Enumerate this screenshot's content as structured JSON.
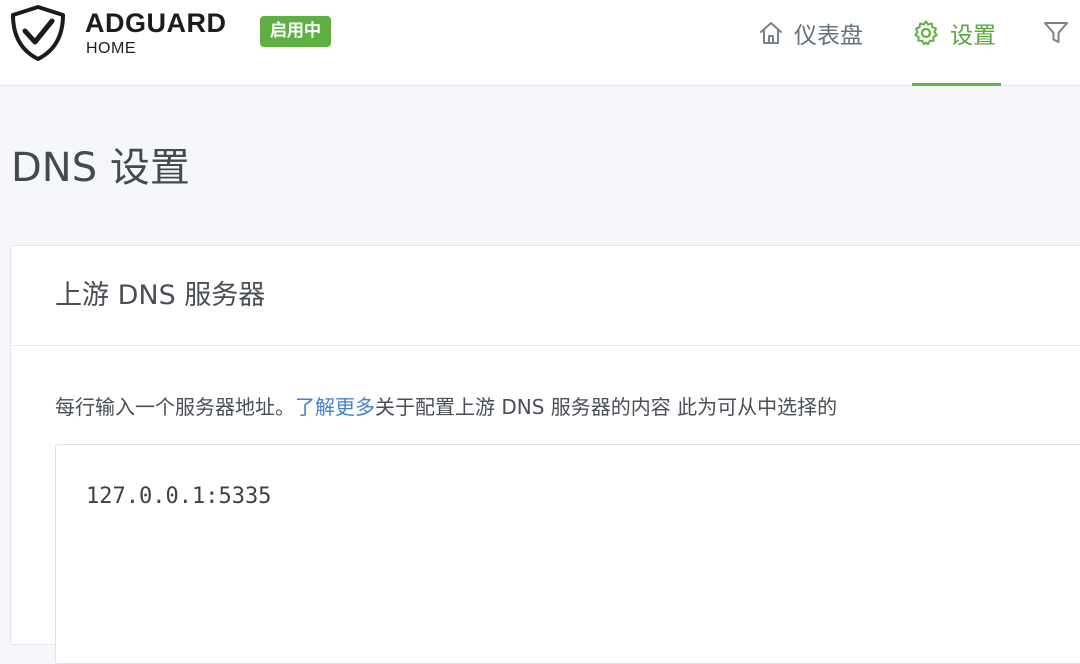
{
  "header": {
    "brand_name": "ADGUARD",
    "brand_sub": "HOME",
    "status_badge": "启用中",
    "logo_icon": "shield-check-icon",
    "nav": [
      {
        "label": "仪表盘",
        "icon": "home-icon"
      },
      {
        "label": "设置",
        "icon": "gear-icon",
        "active": true
      },
      {
        "label": "",
        "icon": "filter-icon"
      }
    ]
  },
  "page": {
    "title": "DNS 设置"
  },
  "card": {
    "title": "上游 DNS 服务器",
    "desc_before": "每行输入一个服务器地址。",
    "desc_link": "了解更多",
    "desc_after": "关于配置上游 DNS 服务器的内容 此为可从中选择的",
    "upstream_value": "127.0.0.1:5335"
  },
  "colors": {
    "accent_green": "#5fb043",
    "link_blue": "#467fcf",
    "nav_gray": "#66707a"
  }
}
